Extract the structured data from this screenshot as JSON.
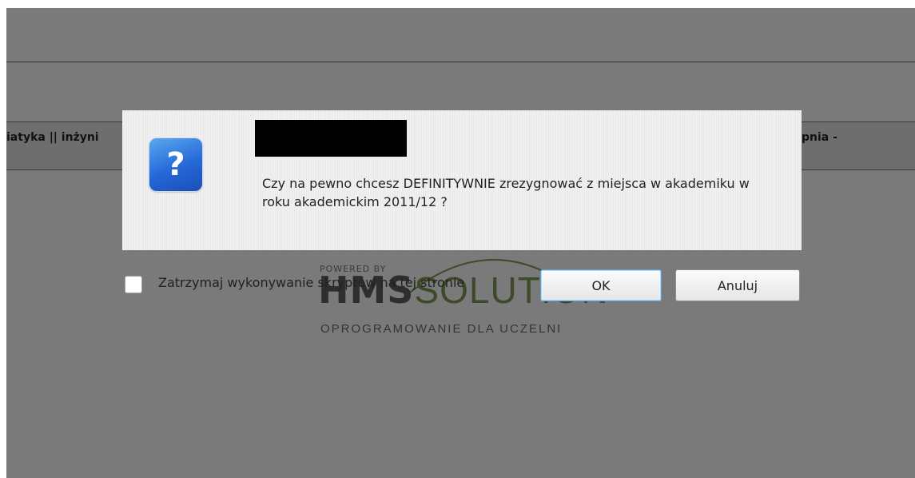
{
  "background": {
    "left_text": "iatyka || inżyni",
    "right_text": "pnia -"
  },
  "watermark": {
    "powered_by": "POWERED BY",
    "brand_hms": "HMS",
    "brand_solution": "SOLUTION",
    "subtitle": "OPROGRAMOWANIE DLA UCZELNI"
  },
  "dialog": {
    "icon": "question-icon",
    "icon_glyph": "?",
    "message": "Czy na pewno chcesz DEFINITYWNIE zrezygnować z miejsca w akademiku w roku akademickim 2011/12 ?",
    "stop_scripts_label": "Zatrzymaj wykonywanie skryptów na tej stronie",
    "ok_label": "OK",
    "cancel_label": "Anuluj"
  }
}
